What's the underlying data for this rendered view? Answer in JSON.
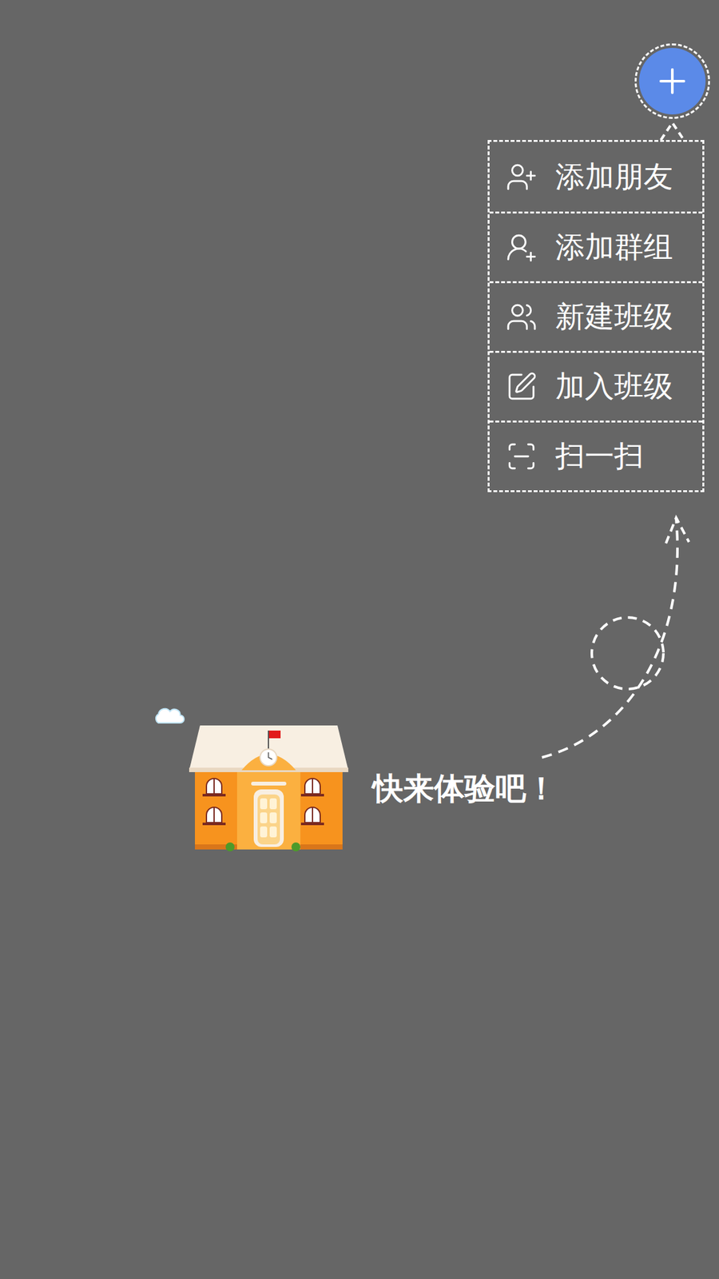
{
  "menu": {
    "items": [
      {
        "label": "添加朋友"
      },
      {
        "label": "添加群组"
      },
      {
        "label": "新建班级"
      },
      {
        "label": "加入班级"
      },
      {
        "label": "扫一扫"
      }
    ]
  },
  "tagline": "快来体验吧！"
}
